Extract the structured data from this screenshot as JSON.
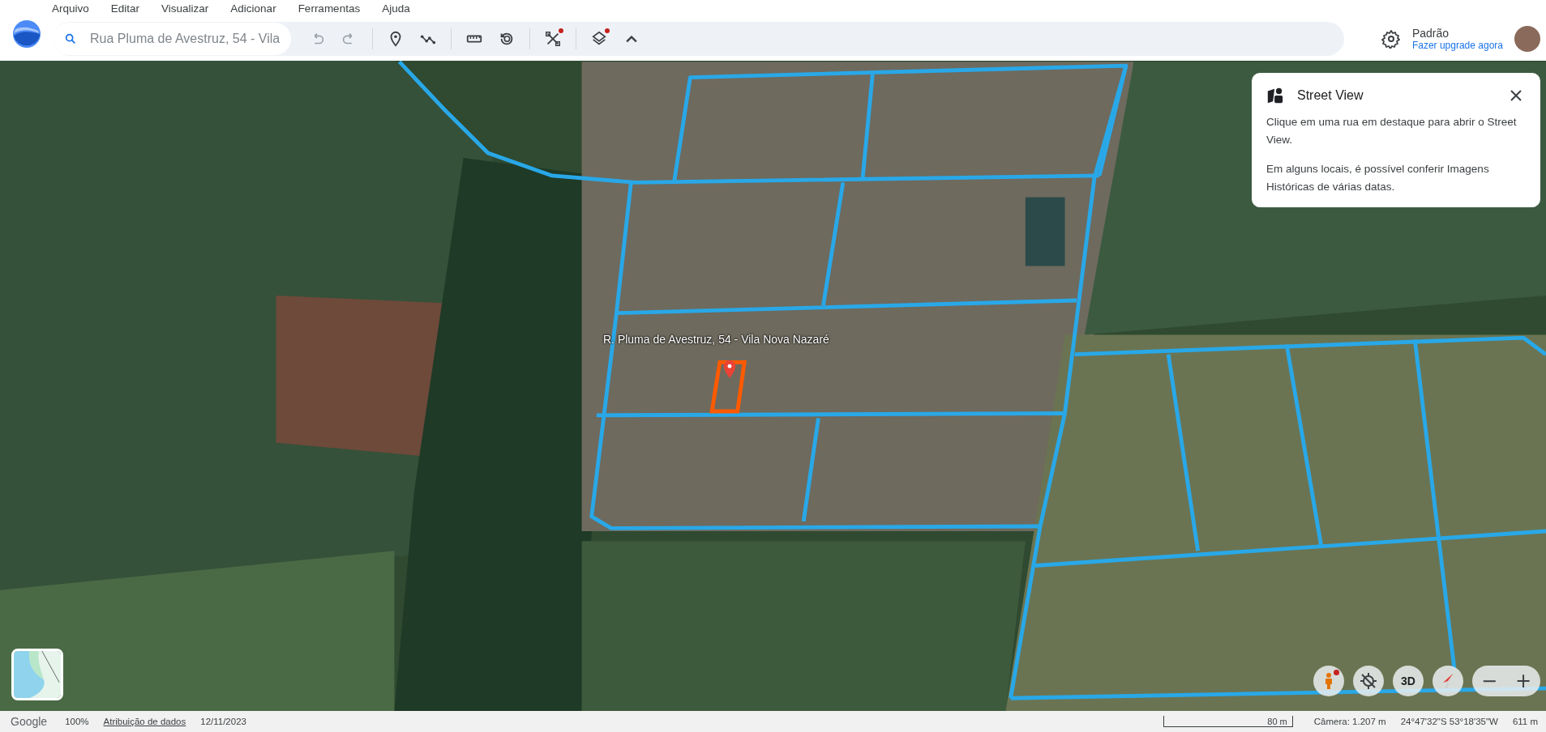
{
  "menu": [
    "Arquivo",
    "Editar",
    "Visualizar",
    "Adicionar",
    "Ferramentas",
    "Ajuda"
  ],
  "search": {
    "placeholder": "Rua Pluma de Avestruz, 54 - Vila"
  },
  "toolbar": [
    {
      "kind": "undo",
      "disabled": true,
      "notification": false
    },
    {
      "kind": "redo",
      "disabled": true,
      "notification": false
    },
    {
      "kind": "separator"
    },
    {
      "kind": "pin",
      "disabled": false,
      "notification": false
    },
    {
      "kind": "path",
      "disabled": false,
      "notification": false
    },
    {
      "kind": "separator"
    },
    {
      "kind": "ruler",
      "disabled": false,
      "notification": false
    },
    {
      "kind": "history",
      "disabled": false,
      "notification": false
    },
    {
      "kind": "separator"
    },
    {
      "kind": "tools",
      "disabled": false,
      "notification": true
    },
    {
      "kind": "separator"
    },
    {
      "kind": "layers",
      "disabled": false,
      "notification": true
    },
    {
      "kind": "caret",
      "disabled": false,
      "notification": false
    }
  ],
  "account": {
    "name": "Padrão",
    "link": "Fazer upgrade agora"
  },
  "map_label": "R. Pluma de Avestruz, 54 - Vila Nova Nazaré",
  "street_view_panel": {
    "title": "Street View",
    "paragraphs": [
      "Clique em uma rua em destaque para abrir o Street View.",
      "Em alguns locais, é possível conferir Imagens Históricas de várias datas."
    ]
  },
  "map_controls": [
    {
      "kind": "pegman",
      "notification": true
    },
    {
      "kind": "location-off",
      "notification": false
    },
    {
      "kind": "text",
      "label": "3D",
      "notification": false
    },
    {
      "kind": "compass",
      "notification": false
    }
  ],
  "zoom_controls": [
    "−",
    "+"
  ],
  "status_bar": {
    "brand": "Google",
    "zoom": "100%",
    "attribution": "Atribuição de dados",
    "date": "12/11/2023",
    "scale": "80 m",
    "camera": "Câmera: 1.207 m",
    "coordinates": "24°47'32\"S 53°18'35\"W",
    "elevation": "611 m"
  }
}
